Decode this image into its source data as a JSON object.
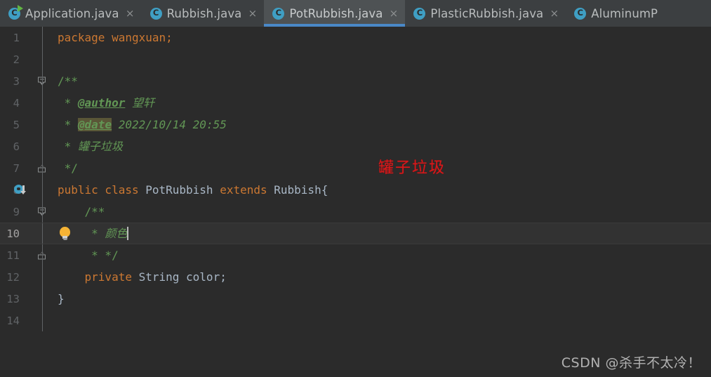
{
  "window": {
    "theme": "darcula",
    "colors": {
      "editor_background": "#2b2b2b",
      "tabbar_background": "#3c3f41",
      "active_tab_background": "#4e5254",
      "active_tab_underline": "#4a88c7",
      "current_line_background": "#323232",
      "keyword": "#cc7832",
      "comment": "#629755",
      "text": "#a9b7c6",
      "line_number": "#606366",
      "annotation_red": "#d8191b",
      "file_icon": "#3f9fc4",
      "lightbulb": "#f5b335"
    }
  },
  "tabs": [
    {
      "label": "Application.java",
      "icon": "java-runnable-class-icon",
      "close": "×",
      "active": false,
      "has_close": true
    },
    {
      "label": "Rubbish.java",
      "icon": "java-class-icon",
      "close": "×",
      "active": false,
      "has_close": true
    },
    {
      "label": "PotRubbish.java",
      "icon": "java-class-icon",
      "close": "×",
      "active": true,
      "has_close": true
    },
    {
      "label": "PlasticRubbish.java",
      "icon": "java-class-icon",
      "close": "×",
      "active": false,
      "has_close": true
    },
    {
      "label": "AluminumP",
      "icon": "java-class-icon",
      "close": "×",
      "active": false,
      "has_close": false
    }
  ],
  "editor": {
    "file": "PotRubbish.java",
    "caret_line": 10,
    "line_numbers": [
      "1",
      "2",
      "3",
      "4",
      "5",
      "6",
      "7",
      "8",
      "9",
      "10",
      "11",
      "12",
      "13",
      "14"
    ],
    "lines": [
      {
        "n": "1",
        "tokens": [
          {
            "t": "package",
            "c": "kw"
          },
          {
            "t": " wangxuan;",
            "c": "plain"
          }
        ]
      },
      {
        "n": "2",
        "tokens": []
      },
      {
        "n": "3",
        "tokens": [
          {
            "t": "/**",
            "c": "cmtp"
          }
        ]
      },
      {
        "n": "4",
        "tokens": [
          {
            "t": " * ",
            "c": "cmt"
          },
          {
            "t": "@author",
            "c": "doctag"
          },
          {
            "t": " 望轩",
            "c": "cmt"
          }
        ]
      },
      {
        "n": "5",
        "tokens": [
          {
            "t": " * ",
            "c": "cmt"
          },
          {
            "t": "@date",
            "c": "doctag hl"
          },
          {
            "t": " 2022/10/14 20:55",
            "c": "cmt"
          }
        ]
      },
      {
        "n": "6",
        "tokens": [
          {
            "t": " * 罐子垃圾",
            "c": "cmt"
          }
        ]
      },
      {
        "n": "7",
        "tokens": [
          {
            "t": " */",
            "c": "cmtp"
          }
        ]
      },
      {
        "n": "8",
        "tokens": [
          {
            "t": "public class ",
            "c": "kw"
          },
          {
            "t": "PotRubbish ",
            "c": "plain"
          },
          {
            "t": "extends ",
            "c": "kw"
          },
          {
            "t": "Rubbish{",
            "c": "plain"
          }
        ]
      },
      {
        "n": "9",
        "tokens": [
          {
            "t": "    /**",
            "c": "cmtp"
          }
        ]
      },
      {
        "n": "10",
        "tokens": [
          {
            "t": "     * ",
            "c": "cmt"
          },
          {
            "t": "颜色",
            "c": "cmt"
          }
        ]
      },
      {
        "n": "11",
        "tokens": [
          {
            "t": "     * */",
            "c": "cmtp"
          }
        ]
      },
      {
        "n": "12",
        "tokens": [
          {
            "t": "    private ",
            "c": "kw"
          },
          {
            "t": "String ",
            "c": "type"
          },
          {
            "t": "color;",
            "c": "plain"
          }
        ]
      },
      {
        "n": "13",
        "tokens": [
          {
            "t": "}",
            "c": "plain"
          }
        ]
      },
      {
        "n": "14",
        "tokens": []
      }
    ],
    "code_text": {
      "l1": "package wangxuan;",
      "l3": "/**",
      "l4_star": " * ",
      "l4_tag": "@author",
      "l4_value": " 望轩",
      "l5_star": " * ",
      "l5_tag": "@date",
      "l5_value": " 2022/10/14 20:55",
      "l6": " * 罐子垃圾",
      "l7": " */",
      "l8_kw1": "public class ",
      "l8_name": "PotRubbish ",
      "l8_kw2": "extends ",
      "l8_super": "Rubbish{",
      "l9": "    /**",
      "l10_star": "     * ",
      "l10_value": "颜色",
      "l11": "     * */",
      "l12_kw": "    private ",
      "l12_type": "String ",
      "l12_name": "color;",
      "l13": "}"
    },
    "gutter_icons": {
      "override_line": "8",
      "override_icon": "overriding-method-icon",
      "intention_line": "10",
      "intention_icon": "lightbulb-icon",
      "fold_open_lines": [
        "3",
        "9"
      ],
      "fold_end_lines": [
        "7",
        "11"
      ]
    }
  },
  "overlay": {
    "annotation": "罐子垃圾",
    "watermark": "CSDN @杀手不太冷！"
  }
}
